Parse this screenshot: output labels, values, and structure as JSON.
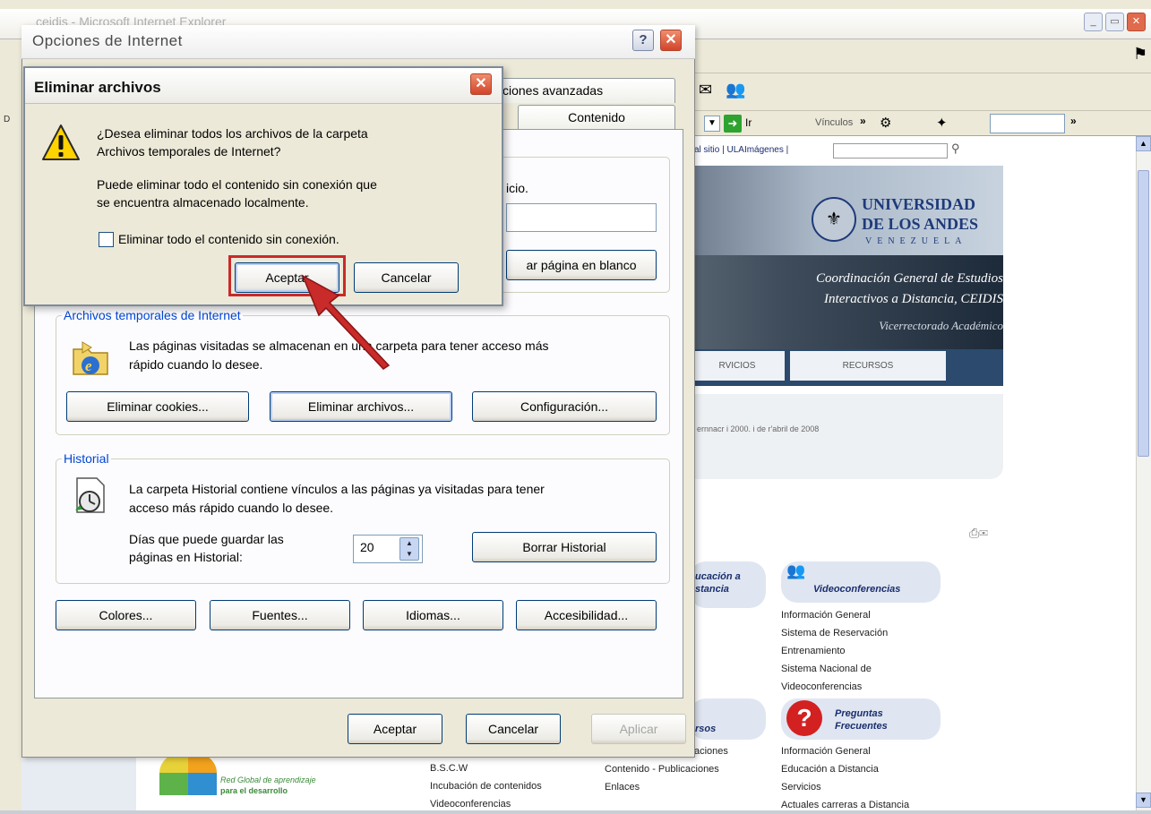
{
  "ie": {
    "title": "ceidis - Microsoft Internet Explorer",
    "go_label": "Ir",
    "links_label": "Vínculos",
    "address_prefix": "D"
  },
  "website": {
    "nav_text": "al sitio | ULAImágenes |",
    "university": [
      "UNIVERSIDAD",
      "DE LOS ANDES",
      "VENEZUELA"
    ],
    "banner_line1": "Coordinación General de Estudios",
    "banner_line2": "Interactivos a Distancia, CEIDIS",
    "banner_line3": "Vicerrectorado Académico",
    "tabs": [
      "RVICIOS",
      "RECURSOS"
    ],
    "date_text": "ernnacr i 2000. i de r'abril de 2008",
    "education_title": "ucación a\nstancia",
    "vc_title": "Videoconferencias",
    "vc_links": [
      "Información General",
      "Sistema de Reservación",
      "Entrenamiento",
      "Sistema Nacional de",
      "Videoconferencias"
    ],
    "recursos_title": "rsos",
    "faq_title": "Preguntas\nFrecuentes",
    "col1_links": [
      "B.S.C.W",
      "Incubación de contenidos",
      "Videoconferencias"
    ],
    "col2_links": [
      "aciones",
      "Contenido - Publicaciones",
      "Enlaces"
    ],
    "faq_links": [
      "Información General",
      "Educación a Distancia",
      "Servicios",
      "Actuales carreras a Distancia"
    ],
    "red_global_1": "Red Global de aprendizaje",
    "red_global_2": "para el desarrollo"
  },
  "options_dialog": {
    "title": "Opciones de Internet",
    "help_label": "?",
    "tabs": [
      "ciones avanzadas",
      "Contenido"
    ],
    "home_text": "icio.",
    "blank_page_button": "ar página en blanco",
    "temp_files": {
      "legend": "Archivos temporales de Internet",
      "description_1": "Las páginas visitadas se almacenan en una carpeta para tener acceso más",
      "description_2": "rápido cuando lo desee.",
      "buttons": [
        "Eliminar cookies...",
        "Eliminar archivos...",
        "Configuración..."
      ]
    },
    "history": {
      "legend": "Historial",
      "description_1": "La carpeta Historial contiene vínculos a las páginas ya visitadas para tener",
      "description_2": "acceso más rápido cuando lo desee.",
      "days_label_1": "Días que puede guardar las",
      "days_label_2": "páginas en Historial:",
      "days_value": "20",
      "clear_button": "Borrar Historial"
    },
    "bottom_buttons": [
      "Colores...",
      "Fuentes...",
      "Idiomas...",
      "Accesibilidad..."
    ],
    "footer_buttons": [
      "Aceptar",
      "Cancelar",
      "Aplicar"
    ]
  },
  "delete_dialog": {
    "title": "Eliminar archivos",
    "question_1": "¿Desea eliminar todos los archivos de la carpeta",
    "question_2": "Archivos temporales de Internet?",
    "info_1": "Puede eliminar todo el contenido sin conexión que",
    "info_2": "se encuentra almacenado localmente.",
    "checkbox_label": "Eliminar todo el contenido sin conexión.",
    "checkbox_checked": false,
    "ok_button": "Aceptar",
    "cancel_button": "Cancelar"
  },
  "colors": {
    "highlight": "#c92a2a",
    "xp_blue_text": "#0046d5"
  }
}
